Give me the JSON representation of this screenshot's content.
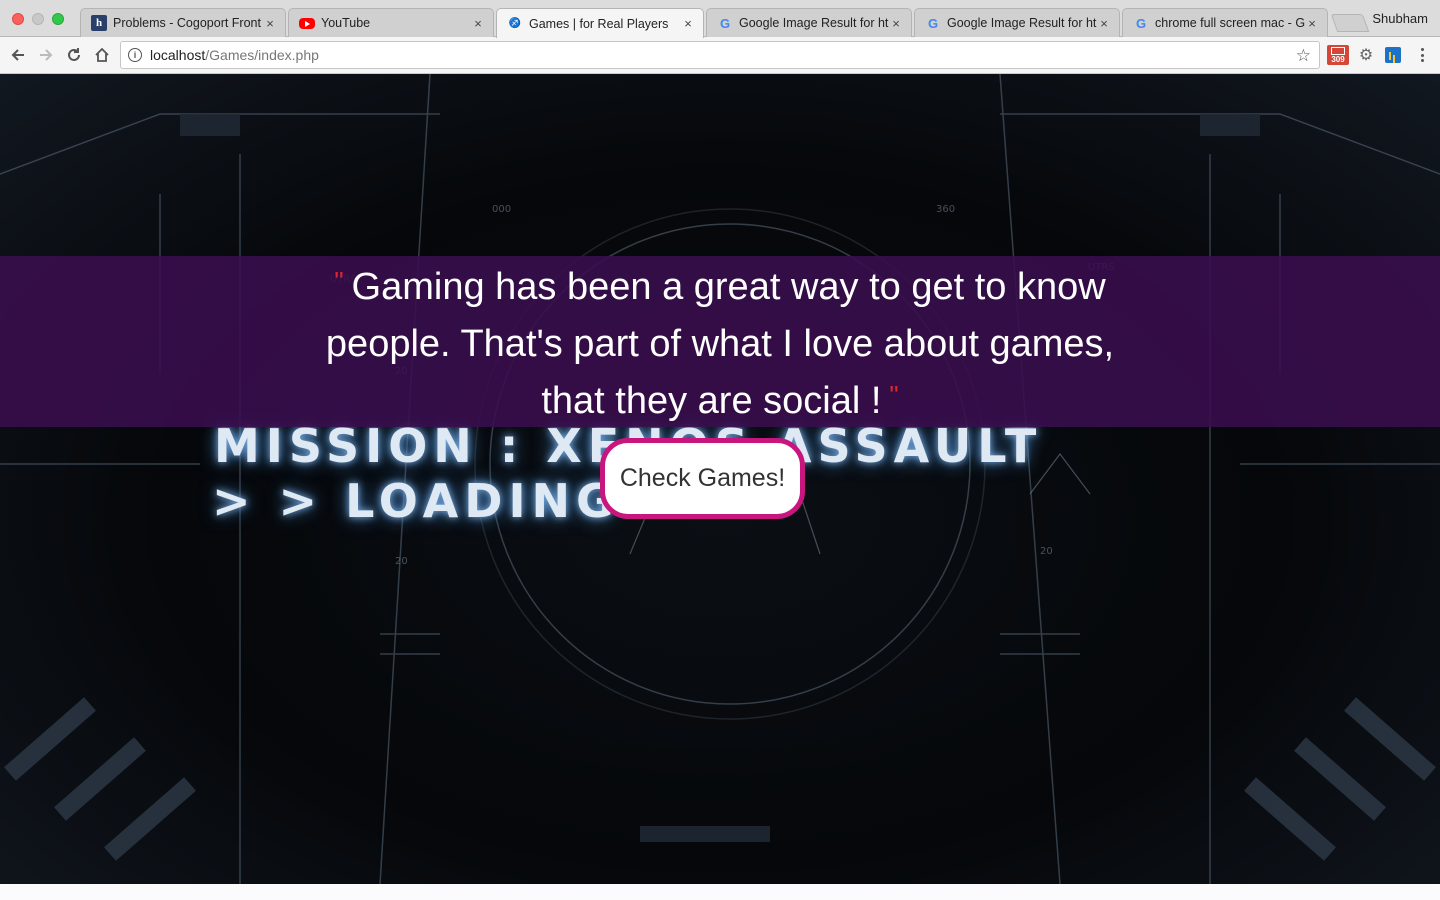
{
  "browser": {
    "tabs": [
      {
        "title": "Problems - Cogoport Front",
        "favicon": "hackerearth-h-icon",
        "fav_glyph": "h",
        "active": false
      },
      {
        "title": "YouTube",
        "favicon": "youtube-icon",
        "fav_glyph": "",
        "active": false
      },
      {
        "title": "Games | for Real Players",
        "favicon": "game-controller-icon",
        "fav_glyph": "♐",
        "active": true
      },
      {
        "title": "Google Image Result for ht",
        "favicon": "google-g-icon",
        "fav_glyph": "G",
        "active": false
      },
      {
        "title": "Google Image Result for ht",
        "favicon": "google-g-icon",
        "fav_glyph": "G",
        "active": false
      },
      {
        "title": "chrome full screen mac - G",
        "favicon": "google-g-icon",
        "fav_glyph": "G",
        "active": false
      }
    ],
    "tab_close_glyph": "×",
    "profile_name": "Shubham",
    "url_host": "localhost",
    "url_path": "/Games/index.php",
    "extension_mail_badge": "309"
  },
  "page": {
    "quote_open": "\"",
    "quote_text": "Gaming has been a great way to get to know people. That's part of what I love about games, that they are social !",
    "quote_close": "\"",
    "mission_line_1": "MISSION : XENOS ASSAULT",
    "mission_line_2": "> > LOADING",
    "cta_label": "Check Games!",
    "colors": {
      "quote_band": "#3a0e4e",
      "quote_marks": "#e0262c",
      "cta_border": "#c8167e"
    }
  }
}
